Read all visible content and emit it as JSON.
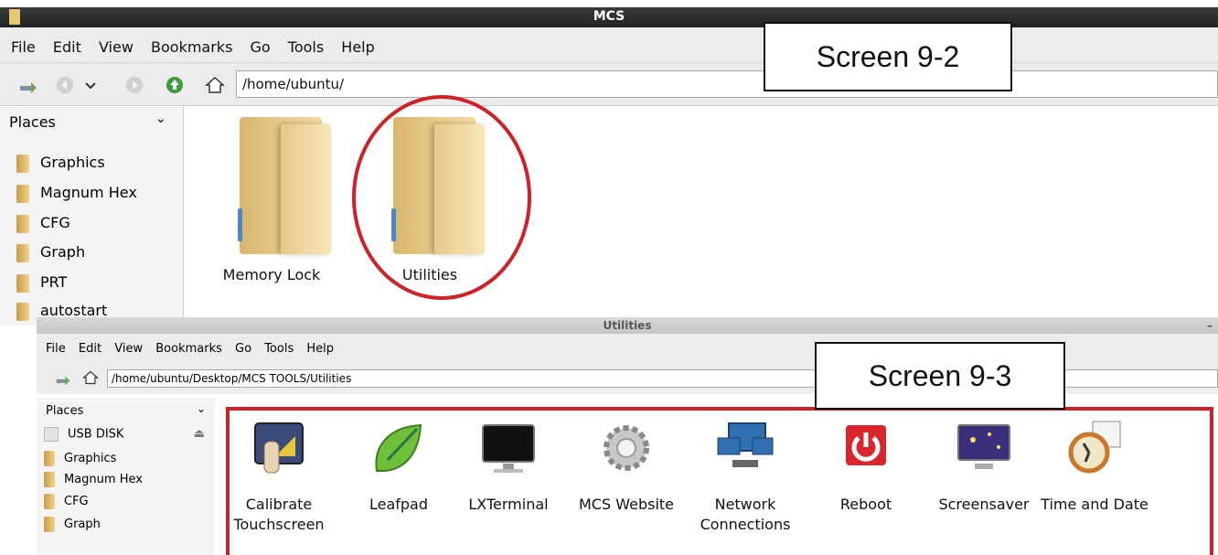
{
  "window1": {
    "title": "MCS",
    "menu": [
      "File",
      "Edit",
      "View",
      "Bookmarks",
      "Go",
      "Tools",
      "Help"
    ],
    "location": "/home/ubuntu/",
    "sidebar": {
      "header": "Places",
      "items": [
        "Graphics",
        "Magnum Hex",
        "CFG",
        "Graph",
        "PRT",
        "autostart"
      ]
    },
    "folders": [
      "Memory Lock",
      "Utilities"
    ]
  },
  "callout1": "Screen 9-2",
  "window2": {
    "title": "Utilities",
    "menu": [
      "File",
      "Edit",
      "View",
      "Bookmarks",
      "Go",
      "Tools",
      "Help"
    ],
    "location": "/home/ubuntu/Desktop/MCS TOOLS/Utilities",
    "sidebar": {
      "header": "Places",
      "items": [
        "USB DISK",
        "Graphics",
        "Magnum Hex",
        "CFG",
        "Graph"
      ]
    },
    "apps": [
      {
        "label": "Calibrate Touchscreen",
        "icon": "calibrate-touchscreen-icon"
      },
      {
        "label": "Leafpad",
        "icon": "leafpad-icon"
      },
      {
        "label": "LXTerminal",
        "icon": "terminal-icon"
      },
      {
        "label": "MCS Website",
        "icon": "gear-icon"
      },
      {
        "label": "Network Connections",
        "icon": "network-icon"
      },
      {
        "label": "Reboot",
        "icon": "power-icon"
      },
      {
        "label": "Screensaver",
        "icon": "screensaver-icon"
      },
      {
        "label": "Time and Date",
        "icon": "clock-icon"
      }
    ]
  },
  "callout2": "Screen 9-3",
  "colors": {
    "highlight": "#cc2229",
    "folder": "#e7c98a"
  }
}
